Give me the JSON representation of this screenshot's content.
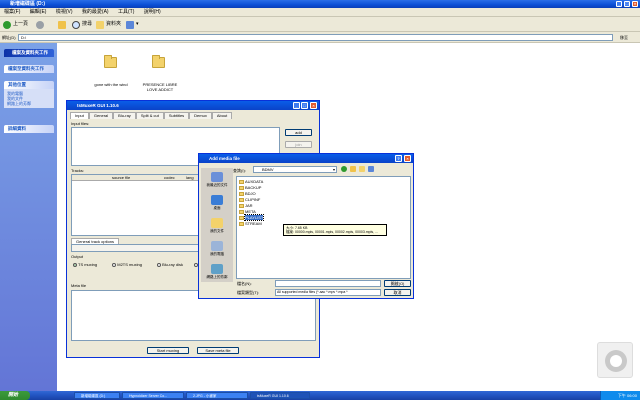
{
  "explorer": {
    "title": "新增磁碟區 (D:)",
    "menu": [
      "檔案(F)",
      "編輯(E)",
      "檢視(V)",
      "我的最愛(A)",
      "工具(T)",
      "說明(H)"
    ],
    "toolbar": {
      "back": "上一頁",
      "search": "搜尋",
      "folders": "資料夾"
    },
    "address_label": "網址(D)",
    "address_value": "D:\\",
    "go_label": "移至",
    "items": [
      {
        "label": "gone with the wind"
      },
      {
        "label": "PRESENCE LIBRE LOVE ADDICT"
      }
    ]
  },
  "taskpane": {
    "file_tasks": {
      "title": "檔案及資料夾工作",
      "items": [
        "檔案至資料夾工作"
      ]
    },
    "other_places": {
      "title": "其他位置",
      "items": [
        "我的電腦",
        "我的文件",
        "網路上的芳鄰"
      ]
    },
    "details": {
      "title": "詳細資料"
    }
  },
  "muxer": {
    "title": "tsMuxeR GUI 1.10.6",
    "tabs": [
      "Input",
      "General",
      "Blu-ray",
      "Split & cut",
      "Subtitles",
      "Demux",
      "About"
    ],
    "input_files_label": "Input files:",
    "add_label": "add",
    "join_label": "join",
    "tracks_label": "Tracks:",
    "columns": [
      "source file",
      "codec",
      "lang"
    ],
    "general_track_tab": "General track options",
    "output_label": "Output",
    "output_options": [
      "TS muxing",
      "M2TS muxing",
      "Blu-ray disk",
      "AVCHD"
    ],
    "meta_file_label": "Meta file",
    "start_label": "Start muxing",
    "save_label": "Save meta file"
  },
  "dialog": {
    "title": "Add media file",
    "lookin_label": "查詢(I):",
    "lookin_value": "BDMV",
    "places": [
      "我最近的文件",
      "桌面",
      "我的文件",
      "我的電腦",
      "網路上的芳鄰"
    ],
    "folders": [
      "AUXDATA",
      "BACKUP",
      "BDJO",
      "CLIPINF",
      "JAR",
      "META",
      "PLAYLIST",
      "STREAM"
    ],
    "selected_folder": "PLAYLIST",
    "tooltip_line1": "大小: 7.65 KB",
    "tooltip_line2": "檔案: 00000.mpls, 00001.mpls, 00002.mpls, 00003.mpls, ...",
    "filename_label": "檔名(N):",
    "filename_value": "",
    "filetype_label": "檔案類型(T):",
    "filetype_value": "All supported media files (*.aac *.mpv *.mpa *",
    "open_label": "開啟(O)",
    "cancel_label": "取消"
  },
  "taskbar": {
    "start_label": "開始",
    "tasks": [
      "新增磁碟區 (D:)",
      "Hypnoidizer Server Co...",
      "2.JPG - 小畫家",
      "tsMuxeR GUI 1.10.6"
    ],
    "clock": "下午 06:00"
  },
  "colors": {
    "accent": "#0a42c8",
    "taskpane": "#6f8de0",
    "taskbar": "#2457c5"
  }
}
